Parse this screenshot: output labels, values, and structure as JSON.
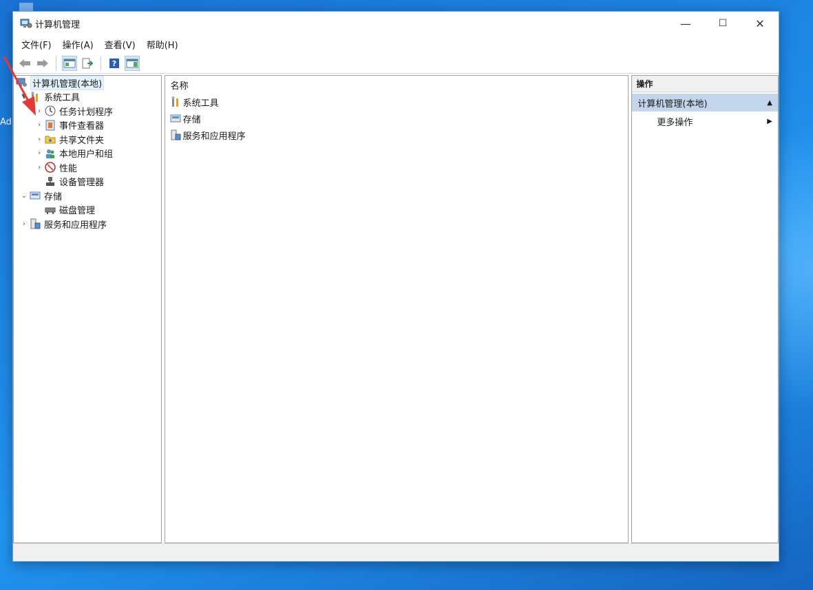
{
  "desktop": {
    "side_label": "Ad"
  },
  "window": {
    "title": "计算机管理",
    "controls": {
      "minimize": "—",
      "maximize": "☐",
      "close": "✕"
    }
  },
  "menubar": {
    "items": [
      {
        "label": "文件(F)"
      },
      {
        "label": "操作(A)"
      },
      {
        "label": "查看(V)"
      },
      {
        "label": "帮助(H)"
      }
    ]
  },
  "toolbar": {
    "buttons": [
      "back-icon",
      "forward-icon",
      "show-hide-tree-icon",
      "export-list-icon",
      "help-icon",
      "show-hide-action-pane-icon"
    ]
  },
  "tree": {
    "root": "计算机管理(本地)",
    "system_tools": "系统工具",
    "task_scheduler": "任务计划程序",
    "event_viewer": "事件查看器",
    "shared_folders": "共享文件夹",
    "local_users": "本地用户和组",
    "performance": "性能",
    "device_manager": "设备管理器",
    "storage": "存储",
    "disk_management": "磁盘管理",
    "services_apps": "服务和应用程序"
  },
  "content": {
    "column_header": "名称",
    "rows": [
      {
        "label": "系统工具",
        "icon": "tools-icon"
      },
      {
        "label": "存储",
        "icon": "storage-icon"
      },
      {
        "label": "服务和应用程序",
        "icon": "services-icon"
      }
    ]
  },
  "actions": {
    "header": "操作",
    "group_label": "计算机管理(本地)",
    "more_actions": "更多操作"
  },
  "colors": {
    "desktop_blue": "#1e88e5",
    "action_group_bg": "#c3d5ea",
    "selection_bg": "#e5f1fb",
    "arrow_red": "#e53935"
  }
}
